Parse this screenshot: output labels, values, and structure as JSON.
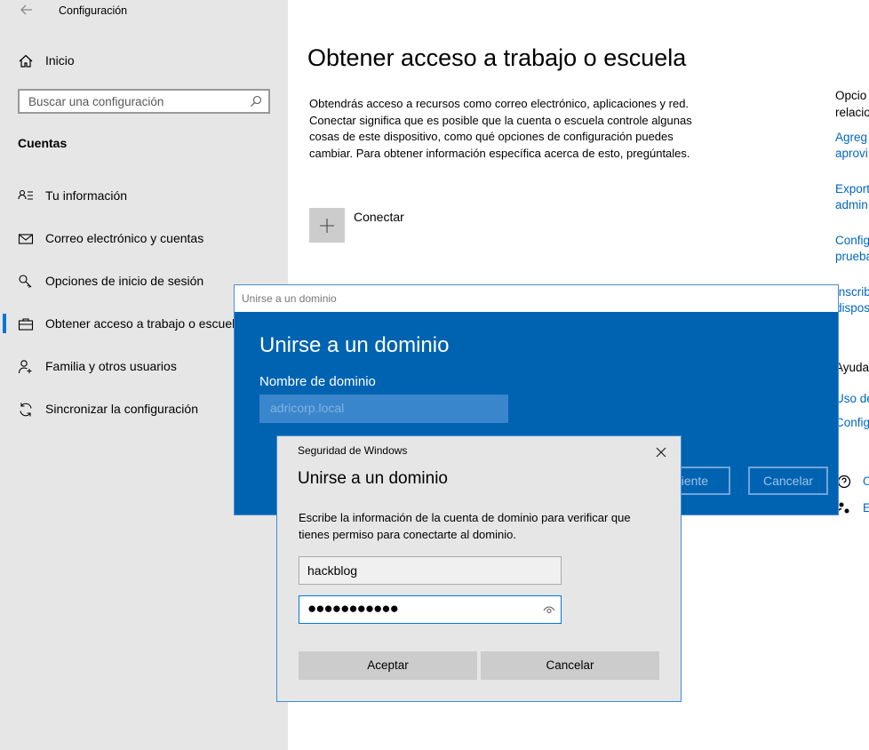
{
  "app": {
    "title": "Configuración"
  },
  "sidebar": {
    "home_label": "Inicio",
    "search_placeholder": "Buscar una configuración",
    "section": "Cuentas",
    "items": [
      {
        "label": "Tu información",
        "icon": "person-info-icon"
      },
      {
        "label": "Correo electrónico y cuentas",
        "icon": "mail-icon"
      },
      {
        "label": "Opciones de inicio de sesión",
        "icon": "key-icon"
      },
      {
        "label": "Obtener acceso a trabajo o escuela",
        "icon": "briefcase-icon",
        "active": true
      },
      {
        "label": "Familia y otros usuarios",
        "icon": "person-add-icon"
      },
      {
        "label": "Sincronizar la configuración",
        "icon": "sync-icon"
      }
    ]
  },
  "main": {
    "title": "Obtener acceso a trabajo o escuela",
    "description": "Obtendrás acceso a recursos como correo electrónico, aplicaciones y red. Conectar significa que es posible que la cuenta o escuela controle algunas cosas de este dispositivo, como qué opciones de configuración puedes cambiar. Para obtener información específica acerca de esto, pregúntales.",
    "connect_label": "Conectar"
  },
  "right_column": {
    "lines": [
      "Opcio",
      "relacio",
      "Agreg",
      "aprovi",
      "Export",
      "admin",
      "Config",
      "prueba",
      "Inscrib",
      "dispos",
      "Ayuda",
      "Uso de",
      "Config",
      "O",
      "E"
    ]
  },
  "domain_dialog": {
    "titlebar": "Unirse a un dominio",
    "heading": "Unirse a un dominio",
    "field_label": "Nombre de dominio",
    "field_value": "adricorp.local",
    "next_label": "uiente",
    "cancel_label": "Cancelar"
  },
  "security_dialog": {
    "title": "Seguridad de Windows",
    "heading": "Unirse a un dominio",
    "message": "Escribe la información de la cuenta de dominio para verificar que tienes permiso para conectarte al dominio.",
    "username": "hackblog",
    "password_mask": "●●●●●●●●●●●",
    "accept_label": "Aceptar",
    "cancel_label": "Cancelar"
  },
  "colors": {
    "accent": "#0078d7",
    "dialog_blue": "#0063b1",
    "link": "#0067c0"
  }
}
